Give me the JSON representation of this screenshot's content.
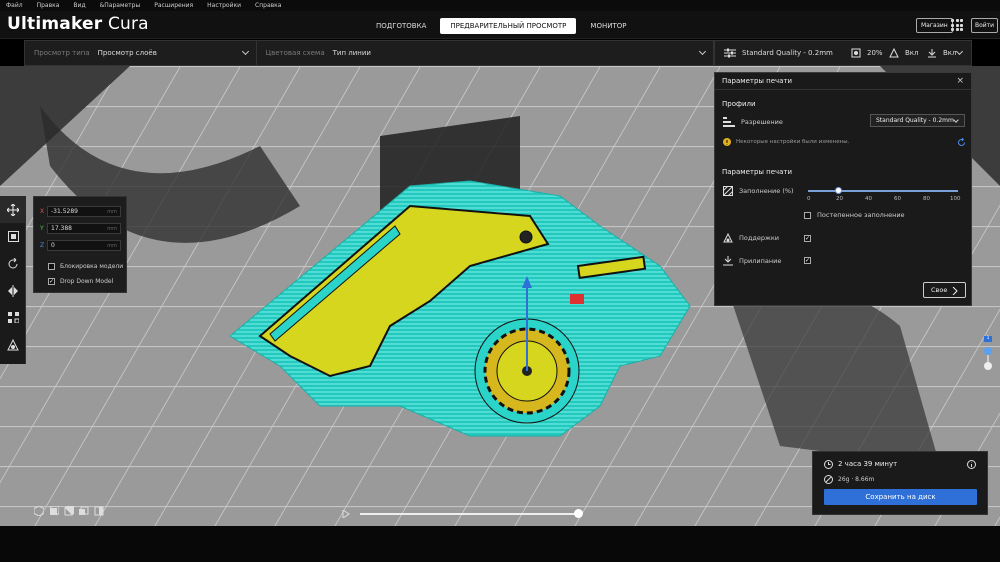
{
  "menu": [
    "Файл",
    "Правка",
    "Вид",
    "&Параметры",
    "Расширения",
    "Настройки",
    "Справка"
  ],
  "app": {
    "brand_bold": "Ultimaker",
    "brand_light": "Cura"
  },
  "stages": [
    {
      "label": "ПОДГОТОВКА",
      "active": false
    },
    {
      "label": "ПРЕДВАРИТЕЛЬНЫЙ ПРОСМОТР",
      "active": true
    },
    {
      "label": "МОНИТОР",
      "active": false
    }
  ],
  "header": {
    "marketplace": "Магазин",
    "login": "Войти"
  },
  "toolbar": {
    "view_type_label": "Просмотр типа",
    "view_type_value": "Просмотр слоёв",
    "color_scheme_label": "Цветовая схема",
    "color_scheme_value": "Тип линии"
  },
  "quality_bar": {
    "profile": "Standard Quality - 0.2mm",
    "infill": "20%",
    "support": "Вкл",
    "adhesion": "Вкл"
  },
  "tools": [
    "move-icon",
    "scale-icon",
    "rotate-icon",
    "mirror-icon",
    "per-model-settings-icon",
    "support-blocker-icon"
  ],
  "move_panel": {
    "x": "-31.5289",
    "y": "17.388",
    "z": "0",
    "unit": "mm",
    "lock_model": "Блокировка модели",
    "lock_checked": false,
    "drop_down": "Drop Down Model",
    "drop_checked": true
  },
  "print_panel": {
    "title": "Параметры печати",
    "profiles_heading": "Профили",
    "resolution_label": "Разрешение",
    "resolution_value": "Standard Quality - 0.2mm",
    "warning": "Некоторые настройки были изменены.",
    "settings_heading": "Параметры печати",
    "infill_label": "Заполнение (%)",
    "infill_value": 20,
    "infill_ticks": [
      "0",
      "20",
      "40",
      "60",
      "80",
      "100"
    ],
    "gradual_infill": "Постепенное заполнение",
    "support_label": "Поддержки",
    "support_checked": true,
    "adhesion_label": "Прилипание",
    "adhesion_checked": true,
    "custom_button": "Свое"
  },
  "job": {
    "time": "2 часа 39 минут",
    "material": "26g · 8.66m",
    "save": "Сохранить на диск"
  },
  "layer": {
    "current": "1"
  },
  "colors": {
    "accent": "#2f6fd8",
    "infill": "#d4d41e",
    "skirt": "#2ad4c8",
    "wall": "#1a1a1a"
  }
}
